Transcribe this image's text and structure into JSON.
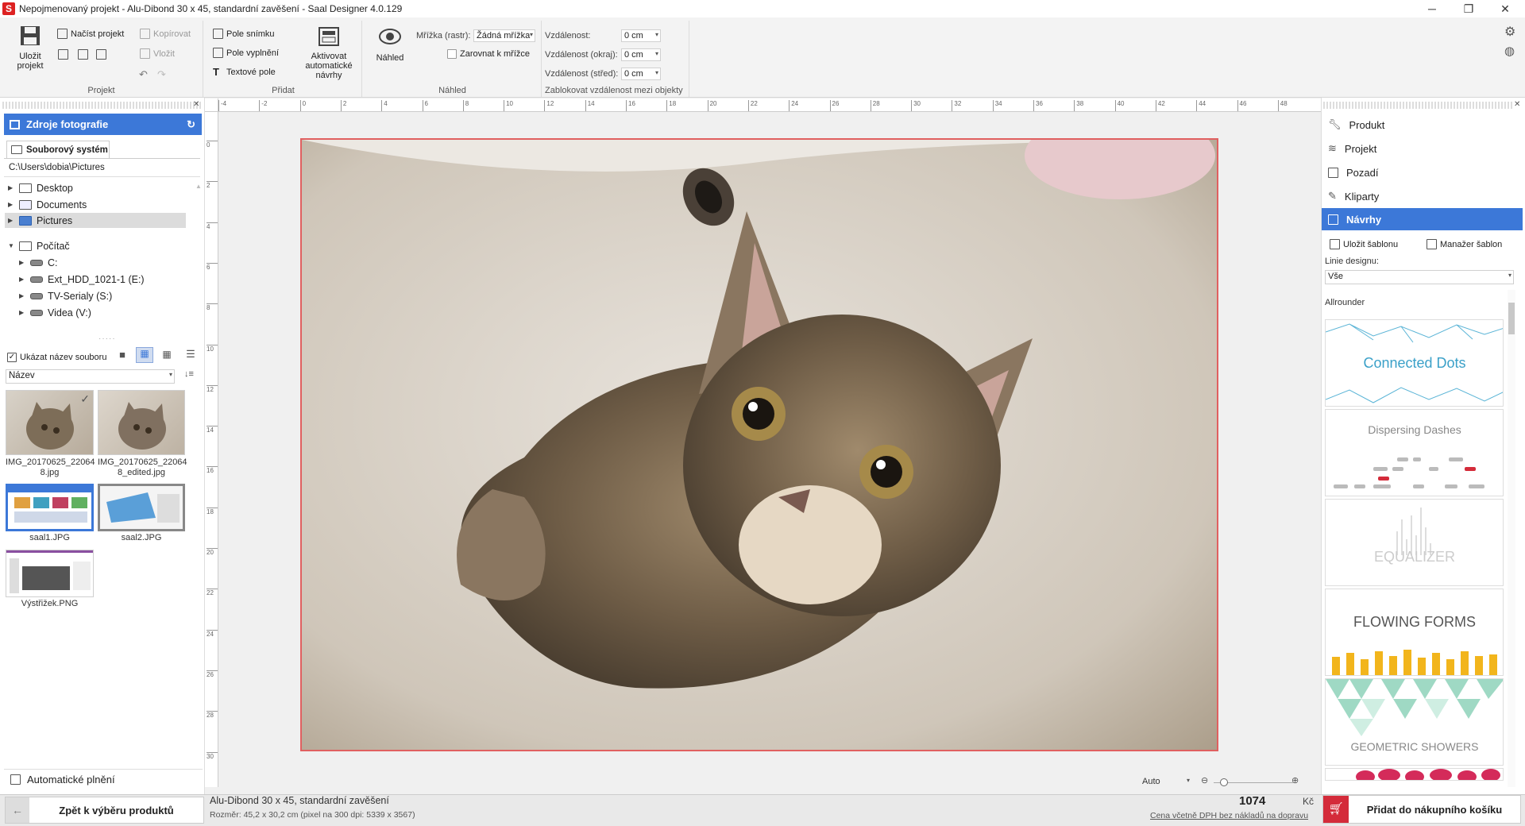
{
  "window": {
    "title": "Nepojmenovaný projekt - Alu-Dibond 30 x 45, standardní zavěšení - Saal Designer 4.0.129",
    "logo_letter": "S"
  },
  "ribbon": {
    "projekt": {
      "label": "Projekt",
      "save": "Uložit projekt",
      "load": "Načíst projekt",
      "copy": "Kopírovat",
      "paste": "Vložit"
    },
    "pridat": {
      "label": "Přidat",
      "photo_field": "Pole snímku",
      "fill_field": "Pole vyplnění",
      "text_field": "Textové pole",
      "auto_designs": "Aktivovat automatické návrhy"
    },
    "nahled": {
      "label": "Náhled",
      "preview": "Náhled",
      "grid_label": "Mřížka (rastr):",
      "grid_value": "Žádná mřížka",
      "snap": "Zarovnat k mřížce"
    },
    "distance": {
      "label": "Zablokovat vzdálenost mezi objekty",
      "d1": "Vzdálenost:",
      "d2": "Vzdálenost (okraj):",
      "d3": "Vzdálenost (střed):",
      "v1": "0 cm",
      "v2": "0 cm",
      "v3": "0 cm"
    }
  },
  "left": {
    "header": "Zdroje fotografie",
    "tab": "Souborový systém",
    "path": "C:\\Users\\dobia\\Pictures",
    "tree": [
      "Desktop",
      "Documents",
      "Pictures",
      "Počítač",
      "C:",
      "Ext_HDD_1021-1 (E:)",
      "TV-Serialy (S:)",
      "Videa (V:)"
    ],
    "show_names": "Ukázat název souboru",
    "sort": "Název",
    "files": [
      {
        "name": "IMG_20170625_220648.jpg",
        "line1": "IMG_20170625_22064",
        "line2": "8.jpg"
      },
      {
        "name": "IMG_20170625_220648_edited.jpg",
        "line1": "IMG_20170625_22064",
        "line2": "8_edited.jpg"
      },
      {
        "name": "saal1.JPG",
        "line1": "saal1.JPG",
        "line2": ""
      },
      {
        "name": "saal2.JPG",
        "line1": "saal2.JPG",
        "line2": ""
      },
      {
        "name": "Výstřižek.PNG",
        "line1": "Výstřižek.PNG",
        "line2": ""
      }
    ],
    "auto_fill": "Automatické plnění",
    "back": "Zpět k výběru produktů"
  },
  "ruler": {
    "top": [
      "-4",
      "-2",
      "0",
      "2",
      "4",
      "6",
      "8",
      "10",
      "12",
      "14",
      "16",
      "18",
      "20",
      "22",
      "24",
      "26",
      "28",
      "30",
      "32",
      "34",
      "36",
      "38",
      "40",
      "42",
      "44",
      "46",
      "48"
    ],
    "left": [
      "0",
      "2",
      "4",
      "6",
      "8",
      "10",
      "12",
      "14",
      "16",
      "18",
      "20",
      "22",
      "24",
      "26",
      "28",
      "30"
    ]
  },
  "zoom": {
    "label": "Auto"
  },
  "right": {
    "nav": [
      "Produkt",
      "Projekt",
      "Pozadí",
      "Kliparty",
      "Návrhy"
    ],
    "save_template": "Uložit šablonu",
    "template_manager": "Manažer šablon",
    "design_line_label": "Linie designu:",
    "design_line_value": "Vše",
    "category": "Allrounder",
    "templates": [
      "Connected Dots",
      "Dispersing Dashes",
      "EQUALIZER",
      "FLOWING FORMS",
      "GEOMETRIC SHOWERS"
    ],
    "add_to_cart": "Přidat do nákupního košíku"
  },
  "status": {
    "product": "Alu-Dibond 30 x 45, standardní zavěšení",
    "size": "Rozměr: 45,2 x 30,2 cm (pixel na 300 dpi: 5339 x 3567)",
    "price": "1074",
    "currency": "Kč",
    "price_note": "Cena včetně DPH bez nákladů na dopravu"
  },
  "colors": {
    "accent": "#3c78d8",
    "cart": "#d42b3a",
    "photo_border": "#e06060"
  }
}
